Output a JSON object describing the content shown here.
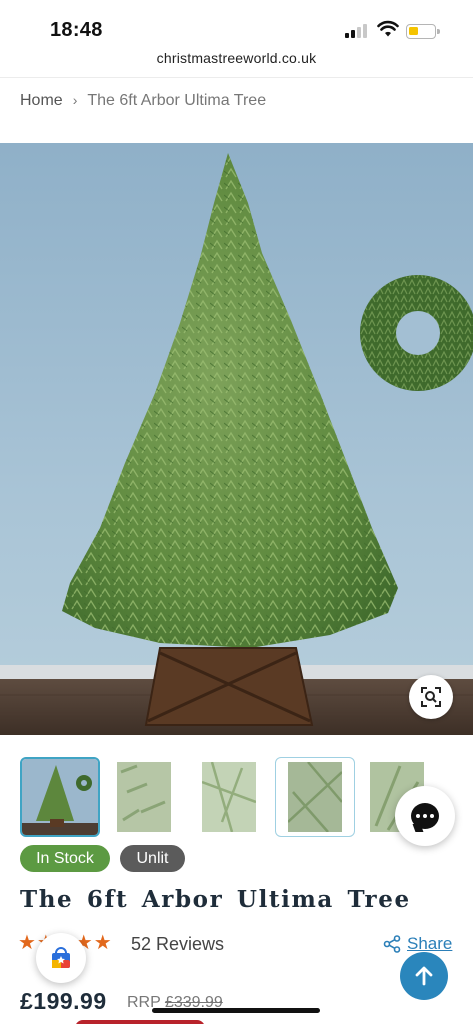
{
  "status_bar": {
    "time": "18:48"
  },
  "browser": {
    "url": "christmastreeworld.co.uk"
  },
  "breadcrumb": {
    "home": "Home",
    "separator": "›",
    "current": "The 6ft Arbor Ultima Tree"
  },
  "gallery": {
    "thumbnails": [
      {
        "subject": "full tree",
        "state": "active"
      },
      {
        "subject": "branch tips close-up",
        "state": ""
      },
      {
        "subject": "needle detail",
        "state": ""
      },
      {
        "subject": "branch detail",
        "state": "selected"
      },
      {
        "subject": "tip detail",
        "state": ""
      }
    ],
    "zoom_icon": "zoom-search-icon"
  },
  "badges": {
    "stock": "In Stock",
    "lit": "Unlit"
  },
  "product": {
    "title": "The 6ft Arbor Ultima Tree",
    "rating_stars": 5,
    "reviews": "52 Reviews",
    "share": "Share",
    "price": "£199.99",
    "rrp_label": "RRP",
    "rrp_price": "£339.99"
  },
  "colors": {
    "accent_blue": "#2a86bc",
    "in_stock_green": "#5c9a42",
    "unlit_grey": "#5b5b5b",
    "star_orange": "#e2681c",
    "title_navy": "#1f2d3a"
  }
}
